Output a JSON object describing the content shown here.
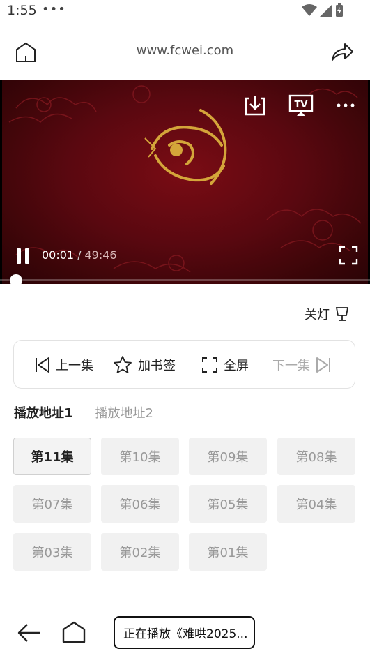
{
  "status": {
    "time": "1:55",
    "dots": "•••"
  },
  "browser": {
    "url": "www.fcwei.com"
  },
  "player": {
    "current_time": "00:01",
    "separator": "/",
    "total_time": "49:46",
    "progress": 0.0003,
    "tv_label": "TV"
  },
  "light_toggle": {
    "label": "关灯"
  },
  "controls": {
    "prev": "上一集",
    "bookmark": "加书签",
    "fullscreen": "全屏",
    "next": "下一集"
  },
  "sources": [
    {
      "label": "播放地址1",
      "active": true
    },
    {
      "label": "播放地址2",
      "active": false
    }
  ],
  "episodes": [
    {
      "label": "第11集",
      "active": true
    },
    {
      "label": "第10集",
      "active": false
    },
    {
      "label": "第09集",
      "active": false
    },
    {
      "label": "第08集",
      "active": false
    },
    {
      "label": "第07集",
      "active": false
    },
    {
      "label": "第06集",
      "active": false
    },
    {
      "label": "第05集",
      "active": false
    },
    {
      "label": "第04集",
      "active": false
    },
    {
      "label": "第03集",
      "active": false
    },
    {
      "label": "第02集",
      "active": false
    },
    {
      "label": "第01集",
      "active": false
    }
  ],
  "nav": {
    "now_playing": "正在播放《难哄2025..."
  },
  "colors": {
    "player_bg": "#5a0810",
    "gold": "#d4a53a"
  }
}
